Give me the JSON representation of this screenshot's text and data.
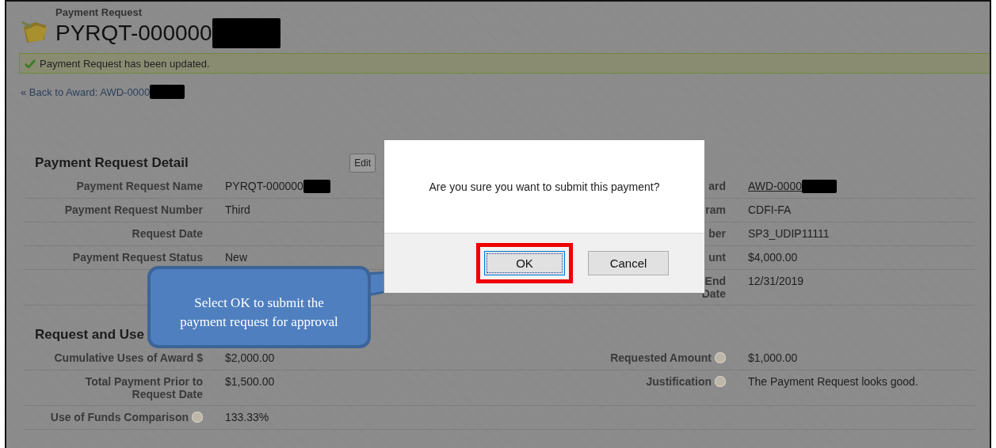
{
  "header": {
    "object_type": "Payment Request",
    "title": "PYRQT-000000",
    "title_redacted": true
  },
  "message": {
    "text": "Payment Request has been updated.",
    "kind": "success"
  },
  "back_link": {
    "text": "« Back to Award: AWD-0000",
    "redacted": true
  },
  "sections": [
    {
      "title": "Payment Request Detail",
      "button": "Edit",
      "rows": [
        {
          "left": {
            "label": "Payment Request Name",
            "value": "PYRQT-000000",
            "redacted": true
          },
          "right": {
            "label": "ard",
            "value": "AWD-0000",
            "redacted": true,
            "link": true
          }
        },
        {
          "left": {
            "label": "Payment Request Number",
            "value": "Third"
          },
          "right": {
            "label": "ram",
            "value": "CDFI-FA"
          }
        },
        {
          "left": {
            "label": "Request Date"
          },
          "right": {
            "label": "ber",
            "value": "SP3_UDIP11111"
          }
        },
        {
          "left": {
            "label": "Payment Request Status",
            "value": "New"
          },
          "right": {
            "label": "unt",
            "value": "$4,000.00"
          }
        },
        {
          "left": {},
          "right": {
            "label": "End Date",
            "value": "12/31/2019"
          }
        }
      ]
    },
    {
      "title": "Request and Use",
      "rows": [
        {
          "left": {
            "label": "Cumulative Uses of Award $",
            "value": "$2,000.00"
          },
          "right": {
            "label": "Requested Amount",
            "value": "$1,000.00",
            "help": true
          }
        },
        {
          "left": {
            "label": "Total Payment Prior to Request Date",
            "value": "$1,500.00"
          },
          "right": {
            "label": "Justification",
            "value": "The Payment Request looks good.",
            "help": true
          }
        },
        {
          "left": {
            "label": "Use of Funds Comparison",
            "value": "133.33%",
            "help": true
          },
          "right": {}
        }
      ]
    }
  ],
  "dialog": {
    "message": "Are you sure you want to submit this payment?",
    "buttons": [
      {
        "label": "OK",
        "focused": true,
        "highlighted": true
      },
      {
        "label": "Cancel",
        "focused": false,
        "highlighted": false
      }
    ]
  },
  "callout": {
    "text": "Select OK to submit the payment request for approval"
  }
}
